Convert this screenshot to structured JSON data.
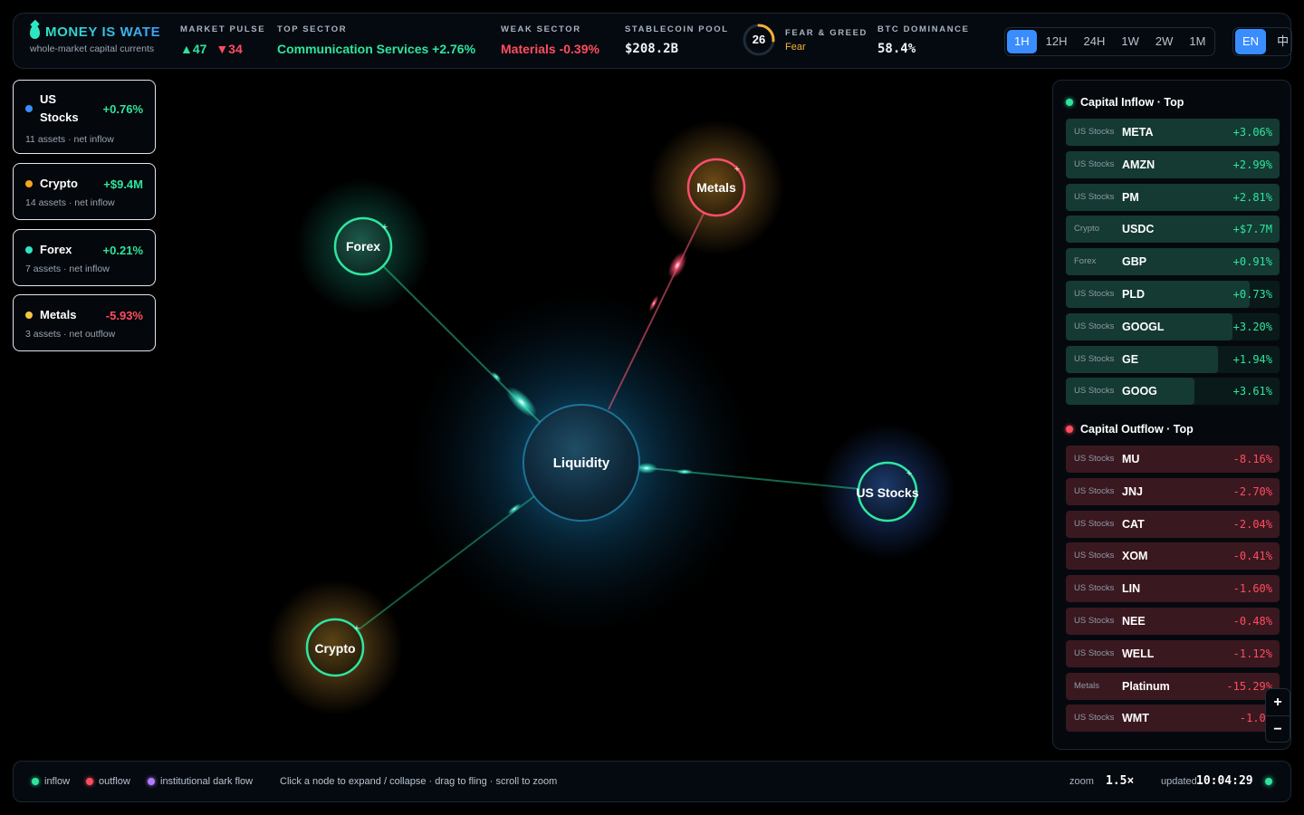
{
  "brand": {
    "title": "MONEY IS WATE",
    "subtitle": "whole-market capital currents"
  },
  "stats": {
    "market_pulse": {
      "label": "MARKET PULSE",
      "up": "▲47",
      "down": "▼34"
    },
    "top_sector": {
      "label": "TOP SECTOR",
      "value": "Communication Services +2.76%"
    },
    "weak_sector": {
      "label": "WEAK SECTOR",
      "value": "Materials -0.39%"
    },
    "stablecoin_pool": {
      "label": "STABLECOIN POOL",
      "value": "$208.2B"
    },
    "fear_greed": {
      "label": "FEAR & GREED",
      "score": "26",
      "score_value": 26,
      "state": "Fear"
    },
    "btc_dominance": {
      "label": "BTC DOMINANCE",
      "value": "58.4%"
    }
  },
  "timeframes": [
    "1H",
    "12H",
    "24H",
    "1W",
    "2W",
    "1M"
  ],
  "active_timeframe": "1H",
  "languages": [
    "EN",
    "中"
  ],
  "active_language": "EN",
  "categories": [
    {
      "name": "US Stocks",
      "change": "+0.76%",
      "sub": "11 assets · net inflow",
      "color": "#3a8dff",
      "direction": "in"
    },
    {
      "name": "Crypto",
      "change": "+$9.4M",
      "sub": "14 assets · net inflow",
      "color": "#f5a524",
      "direction": "in"
    },
    {
      "name": "Forex",
      "change": "+0.21%",
      "sub": "7 assets · net inflow",
      "color": "#2ee6c4",
      "direction": "in"
    },
    {
      "name": "Metals",
      "change": "-5.93%",
      "sub": "3 assets · net outflow",
      "color": "#f5c542",
      "direction": "out"
    }
  ],
  "graph": {
    "center": "Liquidity",
    "nodes": [
      {
        "name": "Forex",
        "flow": "in"
      },
      {
        "name": "Metals",
        "flow": "out"
      },
      {
        "name": "US Stocks",
        "flow": "in"
      },
      {
        "name": "Crypto",
        "flow": "in"
      }
    ]
  },
  "inflow": {
    "title": "Capital Inflow · Top",
    "rows": [
      {
        "cat": "US Stocks",
        "asset": "META",
        "value": "+3.06%",
        "fill": 1.0
      },
      {
        "cat": "US Stocks",
        "asset": "AMZN",
        "value": "+2.99%",
        "fill": 1.0
      },
      {
        "cat": "US Stocks",
        "asset": "PM",
        "value": "+2.81%",
        "fill": 1.0
      },
      {
        "cat": "Crypto",
        "asset": "USDC",
        "value": "+$7.7M",
        "fill": 1.0
      },
      {
        "cat": "Forex",
        "asset": "GBP",
        "value": "+0.91%",
        "fill": 1.0
      },
      {
        "cat": "US Stocks",
        "asset": "PLD",
        "value": "+0.73%",
        "fill": 0.86
      },
      {
        "cat": "US Stocks",
        "asset": "GOOGL",
        "value": "+3.20%",
        "fill": 0.78
      },
      {
        "cat": "US Stocks",
        "asset": "GE",
        "value": "+1.94%",
        "fill": 0.71
      },
      {
        "cat": "US Stocks",
        "asset": "GOOG",
        "value": "+3.61%",
        "fill": 0.6
      }
    ]
  },
  "outflow": {
    "title": "Capital Outflow · Top",
    "rows": [
      {
        "cat": "US Stocks",
        "asset": "MU",
        "value": "-8.16%",
        "fill": 1.0
      },
      {
        "cat": "US Stocks",
        "asset": "JNJ",
        "value": "-2.70%",
        "fill": 1.0
      },
      {
        "cat": "US Stocks",
        "asset": "CAT",
        "value": "-2.04%",
        "fill": 1.0
      },
      {
        "cat": "US Stocks",
        "asset": "XOM",
        "value": "-0.41%",
        "fill": 1.0
      },
      {
        "cat": "US Stocks",
        "asset": "LIN",
        "value": "-1.60%",
        "fill": 1.0
      },
      {
        "cat": "US Stocks",
        "asset": "NEE",
        "value": "-0.48%",
        "fill": 1.0
      },
      {
        "cat": "US Stocks",
        "asset": "WELL",
        "value": "-1.12%",
        "fill": 1.0
      },
      {
        "cat": "Metals",
        "asset": "Platinum",
        "value": "-15.29%",
        "fill": 1.0
      },
      {
        "cat": "US Stocks",
        "asset": "WMT",
        "value": "-1.04",
        "fill": 1.0
      }
    ]
  },
  "zoom_controls": {
    "plus": "+",
    "minus": "−"
  },
  "footer": {
    "legend": [
      "inflow",
      "outflow",
      "institutional dark flow"
    ],
    "legend_colors": [
      "#2ee59d",
      "#ff4d5e",
      "#b07cff"
    ],
    "hint": "Click a node to expand / collapse · drag to fling · scroll to zoom",
    "zoom_label": "zoom",
    "zoom_value": "1.5×",
    "updated_label": "updated",
    "updated_value": "10:04:29"
  },
  "colors": {
    "accent": "#3a8dff",
    "inflow": "#2ee59d",
    "outflow": "#ff4d5e",
    "fear": "#f5b13a"
  }
}
